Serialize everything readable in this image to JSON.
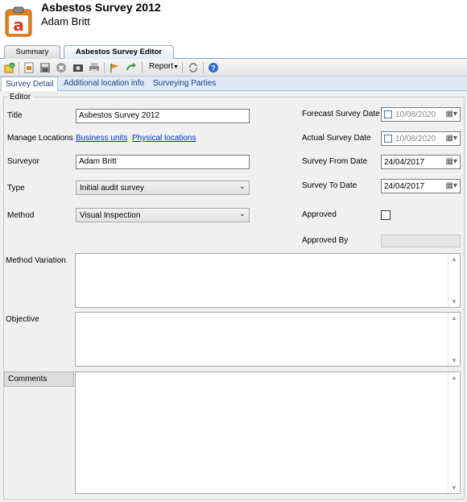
{
  "header": {
    "title": "Asbestos Survey 2012",
    "subtitle": "Adam Britt"
  },
  "tabs": [
    {
      "label": "Summary"
    },
    {
      "label": "Asbestos Survey Editor"
    }
  ],
  "toolbar": {
    "report_label": "Report"
  },
  "subtabs": [
    {
      "label": "Survey Detail"
    },
    {
      "label": "Additional location info"
    },
    {
      "label": "Surveying Parties"
    }
  ],
  "editor": {
    "group_label": "Editor",
    "title_label": "Title",
    "title_value": "Asbestos Survey 2012",
    "manage_locations_label": "Manage Locations",
    "business_units_link": "Business units",
    "physical_locations_link": "Physical locations",
    "surveyor_label": "Surveyor",
    "surveyor_value": "Adam Britt",
    "type_label": "Type",
    "type_value": "Initial audit survey",
    "method_label": "Method",
    "method_value": "Visual Inspection",
    "forecast_label": "Forecast Survey Date",
    "forecast_value": "10/08/2020",
    "actual_label": "Actual Survey Date",
    "actual_value": "10/08/2020",
    "from_label": "Survey From Date",
    "from_value": "24/04/2017",
    "to_label": "Survey To Date",
    "to_value": "24/04/2017",
    "approved_label": "Approved",
    "approved_by_label": "Approved By",
    "approved_by_value": "",
    "method_variation_label": "Method Variation",
    "objective_label": "Objective",
    "comments_label": "Comments"
  },
  "colors": {
    "accent": "#e8801a",
    "link": "#0033cc",
    "tab_active": "#dfe9f6"
  }
}
